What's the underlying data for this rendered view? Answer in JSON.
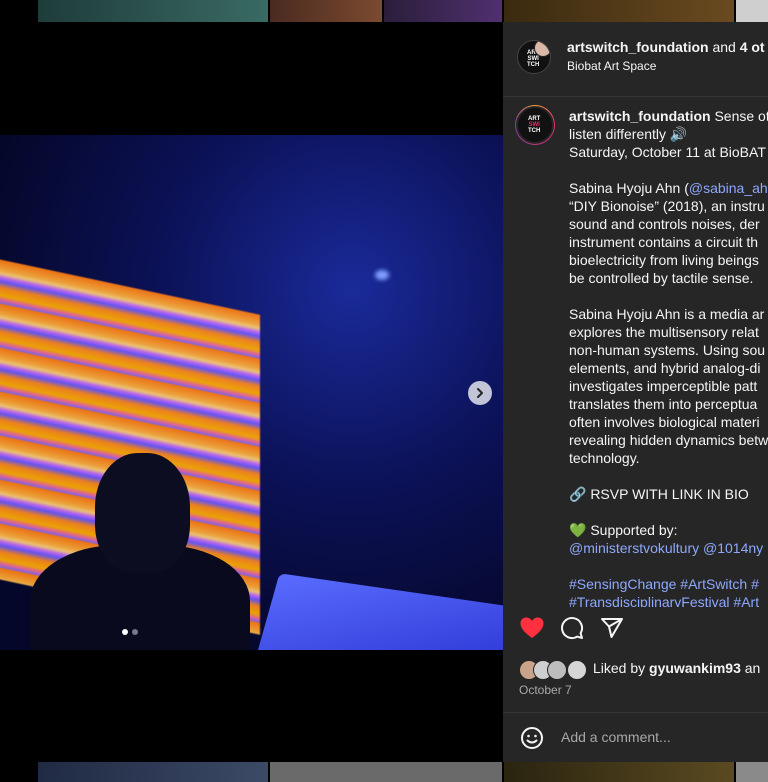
{
  "header": {
    "account": "artswitch_foundation",
    "joiner": "and",
    "others": "4 ot",
    "location": "Biobat Art Space"
  },
  "logo_text": [
    "ART",
    "SWI",
    "TCH"
  ],
  "caption": {
    "username": "artswitch_foundation",
    "line1_rest": " Sense ot",
    "line2": "listen differently 🔊",
    "line3": "Saturday, October 11 at BioBAT",
    "para1_line1_start": "Sabina Hyoju Ahn (",
    "para1_line1_mention": "@sabina_ah",
    "para1_line2": "“DIY Bionoise” (2018), an instru",
    "para1_line3": "sound and controls noises, der",
    "para1_line4": "instrument contains a circuit th",
    "para1_line5": "bioelectricity from living beings",
    "para1_line6": "be controlled by tactile sense.",
    "para2_line1": "Sabina Hyoju Ahn is a media ar",
    "para2_line2": "explores the multisensory relat",
    "para2_line3": "non-human systems. Using sou",
    "para2_line4": "elements, and hybrid analog-di",
    "para2_line5": "investigates imperceptible patt",
    "para2_line6": "translates them into perceptua",
    "para2_line7": "often involves biological materi",
    "para2_line8": "revealing hidden dynamics betw",
    "para2_line9": "technology.",
    "rsvp": "🔗 RSVP WITH LINK IN BIO",
    "supported": "💚 Supported by:",
    "supporters": "@ministerstvokultury @1014ny",
    "hashtags1": "#SensingChange #ArtSwitch #",
    "hashtags2": "#TransdisciplinaryFestival #Art"
  },
  "likes": {
    "prefix": "Liked by ",
    "user": "gyuwankim93",
    "suffix": " an"
  },
  "date": "October 7",
  "comment": {
    "placeholder": "Add a comment..."
  },
  "carousel": {
    "slides_visible_dots": 2,
    "active_index": 0
  },
  "colors": {
    "like_red": "#ff3040",
    "link_blue": "#8ea8ff",
    "panel_bg": "#262626"
  }
}
